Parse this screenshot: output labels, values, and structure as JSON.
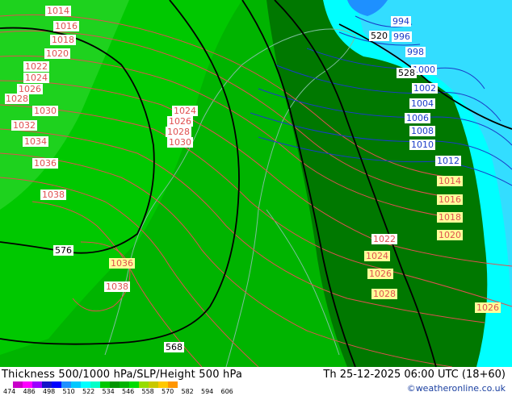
{
  "title": "Thickness 500/1000 hPa/SLP/Height 500 hPa",
  "datetime": "Th 25-12-2025 06:00 UTC (18+60)",
  "credit": "©weatheronline.co.uk",
  "legend": {
    "ticks": [
      "474",
      "486",
      "498",
      "510",
      "522",
      "534",
      "546",
      "558",
      "570",
      "582",
      "594",
      "606"
    ],
    "colors": [
      "#c800c8",
      "#ff00ff",
      "#9b00ff",
      "#1414c8",
      "#0000ff",
      "#1e90ff",
      "#00c8ff",
      "#00ffff",
      "#00ffc8",
      "#00c800",
      "#009600",
      "#00b400",
      "#00dc00",
      "#96dc00",
      "#c8c800",
      "#ffc800",
      "#ff9600"
    ]
  },
  "slp_labels_red": [
    "1014",
    "1016",
    "1018",
    "1020",
    "1022",
    "1024",
    "1026",
    "1028",
    "1030",
    "1032",
    "1034",
    "1036",
    "1038",
    "1024",
    "1026",
    "1028",
    "1030",
    "1036",
    "1038",
    "1014",
    "1016",
    "1018",
    "1020",
    "1022",
    "1024",
    "1026",
    "1028",
    "1026"
  ],
  "slp_labels_blue": [
    "994",
    "996",
    "998",
    "1000",
    "1002",
    "1004",
    "1006",
    "1008",
    "1010",
    "1012"
  ],
  "height_labels": [
    "576",
    "568",
    "520",
    "528",
    "528"
  ],
  "colors": {
    "thickness_546": "#009600",
    "thickness_552": "#00b400",
    "thickness_558": "#00c800",
    "thickness_540": "#007800",
    "thickness_534": "#00ffff",
    "thickness_528": "#33ddff",
    "slp_high": "#e05050",
    "slp_low": "#1a3cc8",
    "height": "#000000"
  }
}
